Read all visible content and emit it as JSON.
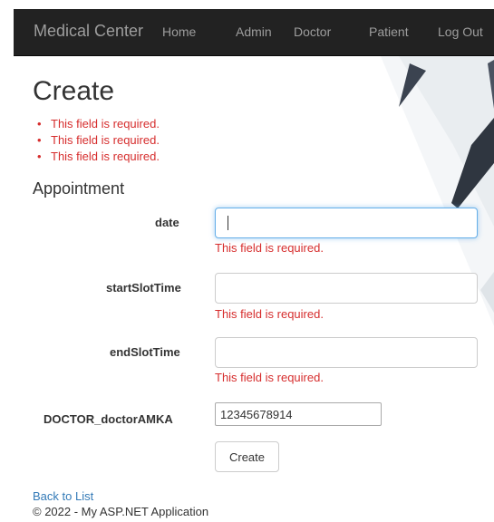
{
  "navbar": {
    "brand": "Medical Center",
    "links": [
      {
        "label": "Home"
      },
      {
        "label": "Admin"
      },
      {
        "label": "Doctor"
      },
      {
        "label": "Patient"
      },
      {
        "label": "Log Out"
      }
    ]
  },
  "page": {
    "title": "Create",
    "validation_summary": [
      "This field is required.",
      "This field is required.",
      "This field is required."
    ],
    "legend": "Appointment"
  },
  "form": {
    "date": {
      "label": "date",
      "value": "",
      "error": "This field is required."
    },
    "start_slot_time": {
      "label": "startSlotTime",
      "value": "",
      "error": "This field is required."
    },
    "end_slot_time": {
      "label": "endSlotTime",
      "value": "",
      "error": "This field is required."
    },
    "doctor_amka": {
      "label": "DOCTOR_doctorAMKA",
      "value": "12345678914"
    },
    "submit_label": "Create"
  },
  "back_link": "Back to List",
  "footer": "© 2022 - My ASP.NET Application",
  "colors": {
    "navbar_bg": "#222222",
    "nav_text": "#9d9d9d",
    "error": "#d62d2d",
    "link": "#337ab7",
    "focus_border": "#66afe9"
  }
}
